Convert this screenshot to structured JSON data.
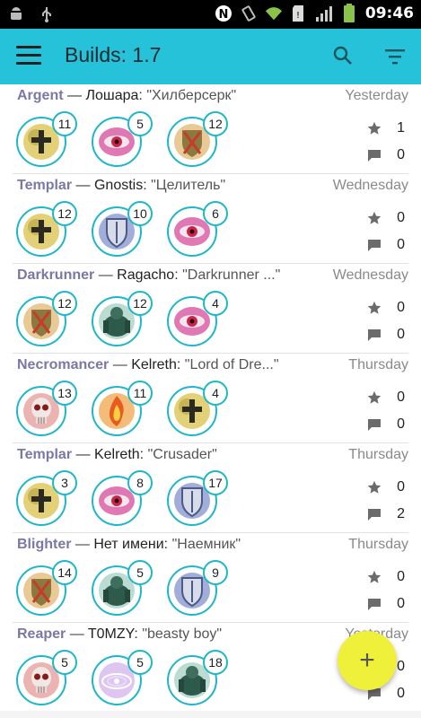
{
  "status_bar": {
    "time": "09:46"
  },
  "app_bar": {
    "title": "Builds: 1.7"
  },
  "builds": [
    {
      "class": "Argent",
      "author": "Лошара",
      "name": "\"Хилберсерк\"",
      "date": "Yesterday",
      "skills": [
        {
          "icon": "cross",
          "level": "11"
        },
        {
          "icon": "eye",
          "level": "5"
        },
        {
          "icon": "shield-sword",
          "level": "12"
        }
      ],
      "stars": "1",
      "comments": "0"
    },
    {
      "class": "Templar",
      "author": "Gnostis",
      "name": "\"Целитель\"",
      "date": "Wednesday",
      "skills": [
        {
          "icon": "cross",
          "level": "12"
        },
        {
          "icon": "shield",
          "level": "10"
        },
        {
          "icon": "eye",
          "level": "6"
        }
      ],
      "stars": "0",
      "comments": "0"
    },
    {
      "class": "Darkrunner",
      "author": "Ragacho",
      "name": "\"Darkrunner ...\"",
      "date": "Wednesday",
      "skills": [
        {
          "icon": "shield-sword",
          "level": "12"
        },
        {
          "icon": "golem",
          "level": "12"
        },
        {
          "icon": "eye",
          "level": "4"
        }
      ],
      "stars": "0",
      "comments": "0"
    },
    {
      "class": "Necromancer",
      "author": "Kelreth",
      "name": "\"Lord of Dre...\"",
      "date": "Thursday",
      "skills": [
        {
          "icon": "skull",
          "level": "13"
        },
        {
          "icon": "fire",
          "level": "11"
        },
        {
          "icon": "cross",
          "level": "4"
        }
      ],
      "stars": "0",
      "comments": "0"
    },
    {
      "class": "Templar",
      "author": "Kelreth",
      "name": "\"Crusader\"",
      "date": "Thursday",
      "skills": [
        {
          "icon": "cross",
          "level": "3"
        },
        {
          "icon": "eye",
          "level": "8"
        },
        {
          "icon": "shield",
          "level": "17"
        }
      ],
      "stars": "0",
      "comments": "2"
    },
    {
      "class": "Blighter",
      "author": "Нет имени",
      "name": "\"Наемник\"",
      "date": "Thursday",
      "skills": [
        {
          "icon": "shield-sword",
          "level": "14"
        },
        {
          "icon": "golem",
          "level": "5"
        },
        {
          "icon": "shield",
          "level": "9"
        }
      ],
      "stars": "0",
      "comments": "0"
    },
    {
      "class": "Reaper",
      "author": "T0MZY",
      "name": "\"beasty boy\"",
      "date": "Yesterday",
      "skills": [
        {
          "icon": "skull",
          "level": "5"
        },
        {
          "icon": "vortex",
          "level": "5"
        },
        {
          "icon": "golem",
          "level": "18"
        }
      ],
      "stars": "0",
      "comments": "0"
    }
  ],
  "fab": {
    "label": "+"
  },
  "colors": {
    "accent": "#26c2d9",
    "fab": "#eef03a",
    "class_text": "#7a78a6",
    "ring": "#1fb6c9"
  }
}
